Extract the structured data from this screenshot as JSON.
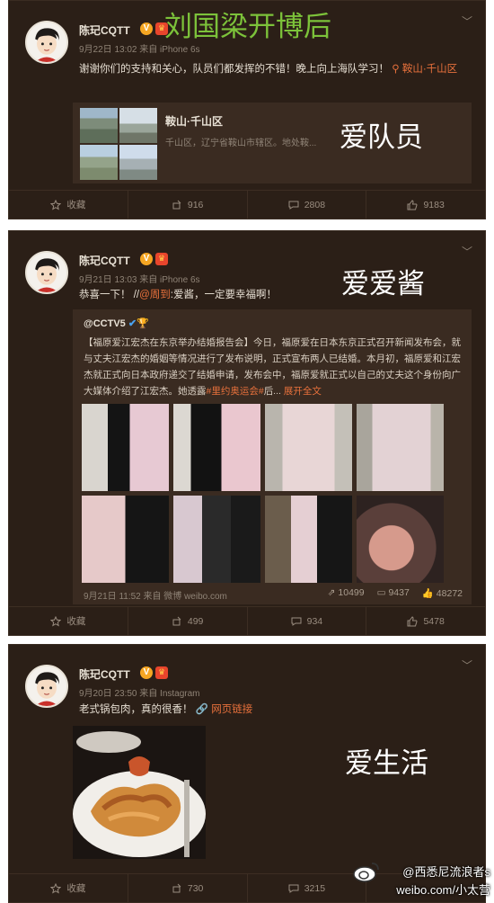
{
  "title_overlay": "刘国梁开博后",
  "posts": [
    {
      "username": "陈玘CQTT",
      "meta": "9月22日 13:02 来自 iPhone 6s",
      "text": "谢谢你们的支持和关心，队员们都发挥的不错！晚上向上海队学习！",
      "location_inline": "鞍山·千山区",
      "overlay": "爱队员",
      "location_card": {
        "title": "鞍山·千山区",
        "desc": "千山区，辽宁省鞍山市辖区。地处鞍..."
      },
      "actions": {
        "favorite": "收藏",
        "repost": "916",
        "comment": "2808",
        "like": "9183"
      }
    },
    {
      "username": "陈玘CQTT",
      "meta": "9月21日 13:03 来自 iPhone 6s",
      "text_prefix": "恭喜一下！ //",
      "mention": "@周到",
      "text_suffix": ":爱酱，一定要幸福啊！",
      "overlay": "爱爱酱",
      "repost": {
        "user": "@CCTV5",
        "text_main": "【福原爱江宏杰在东京举办结婚报告会】今日，福原爱在日本东京正式召开新闻发布会，就与丈夫江宏杰的婚姻等情况进行了发布说明，正式宣布两人已结婚。本月初，福原爱和江宏杰就正式向日本政府递交了结婚申请，发布会中，福原爱就正式以自己的丈夫这个身份向广大媒体介绍了江宏杰。她透露",
        "hashtag": "#里约奥运会#",
        "text_tail": "后...",
        "expand": "展开全文",
        "meta": "9月21日 11:52 来自 微博 weibo.com",
        "stats": {
          "repost": "10499",
          "comment": "9437",
          "like": "48272"
        }
      },
      "actions": {
        "favorite": "收藏",
        "repost": "499",
        "comment": "934",
        "like": "5478"
      }
    },
    {
      "username": "陈玘CQTT",
      "meta": "9月20日 23:50 来自 Instagram",
      "text": "老式锅包肉，真的很香！",
      "link": "网页链接",
      "overlay": "爱生活",
      "actions": {
        "favorite": "收藏",
        "repost": "730",
        "comment": "3215"
      }
    }
  ],
  "watermark": {
    "line1": "@西悉尼流浪者s",
    "line2": "weibo.com/小太营"
  }
}
